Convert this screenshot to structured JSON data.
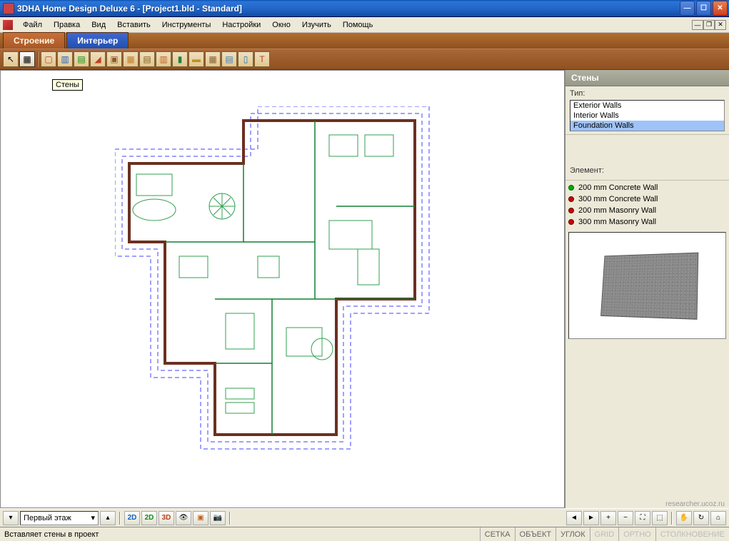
{
  "window": {
    "title": "3DHA Home Design Deluxe 6 - [Project1.bld - Standard]"
  },
  "menu": {
    "items": [
      "Файл",
      "Правка",
      "Вид",
      "Вставить",
      "Инструменты",
      "Настройки",
      "Окно",
      "Изучить",
      "Помощь"
    ]
  },
  "tabs": {
    "structure": "Строение",
    "interior": "Интерьер"
  },
  "toolbar_icons": [
    "arrow",
    "roof",
    "wall",
    "door",
    "window",
    "section",
    "stairs",
    "column",
    "beam",
    "rail",
    "hatch",
    "dim",
    "text",
    "texture",
    "measure",
    "paint",
    "light"
  ],
  "canvas": {
    "tooltip": "Стены"
  },
  "side_panel": {
    "title": "Стены",
    "type_label": "Тип:",
    "types": [
      {
        "label": "Exterior Walls",
        "selected": false
      },
      {
        "label": "Interior Walls",
        "selected": false
      },
      {
        "label": "Foundation Walls",
        "selected": true
      }
    ],
    "element_label": "Элемент:",
    "elements": [
      {
        "label": "200 mm Concrete Wall",
        "color": "green"
      },
      {
        "label": "300 mm Concrete Wall",
        "color": "red"
      },
      {
        "label": "200 mm Masonry Wall",
        "color": "red"
      },
      {
        "label": "300 mm Masonry Wall",
        "color": "red"
      }
    ]
  },
  "bottom": {
    "floor": "Первый этаж",
    "v2d": "2D",
    "v2dg": "2D",
    "v3d": "3D"
  },
  "status": {
    "hint": "Вставляет стены в проект",
    "cells": [
      "СЕТКА",
      "ОБЪЕКТ",
      "УГЛОК"
    ],
    "dim_cells": [
      "GRID",
      "ОРТНО",
      "СТОЛКНОВЕНИЕ"
    ],
    "watermark": "researcher.ucoz.ru"
  }
}
